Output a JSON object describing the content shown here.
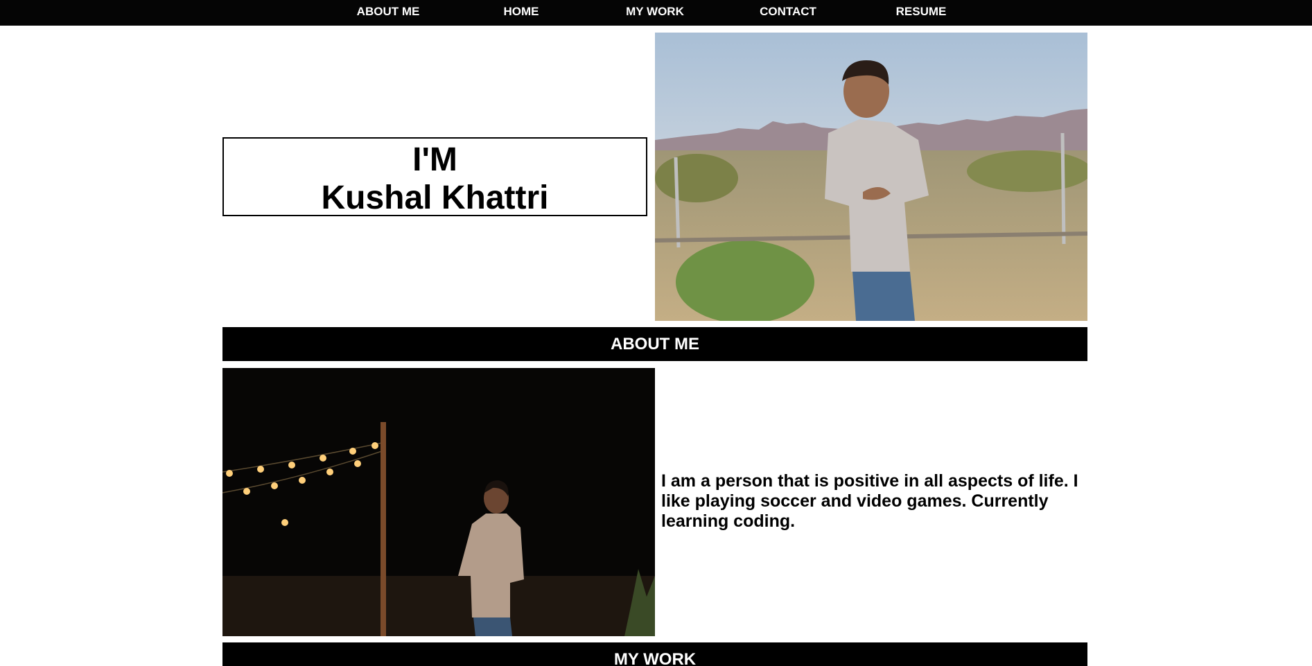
{
  "nav": {
    "items": [
      {
        "label": "ABOUT ME"
      },
      {
        "label": "HOME"
      },
      {
        "label": "MY WORK"
      },
      {
        "label": "CONTACT"
      },
      {
        "label": "RESUME"
      }
    ]
  },
  "hero": {
    "line1": "I'M",
    "line2": "Kushal Khattri",
    "photo_alt": "Kushal Khattri standing in a desert landscape"
  },
  "about": {
    "heading": "ABOUT ME",
    "text": "I am a person that is positive in all aspects of life. I like playing soccer and video games. Currently learning coding.",
    "photo_alt": "Kushal Khattri at night under string lights"
  },
  "work": {
    "heading": "MY WORK"
  },
  "colors": {
    "nav_bg": "#050505",
    "section_bar_bg": "#000000",
    "text": "#000000",
    "nav_text": "#ffffff"
  }
}
